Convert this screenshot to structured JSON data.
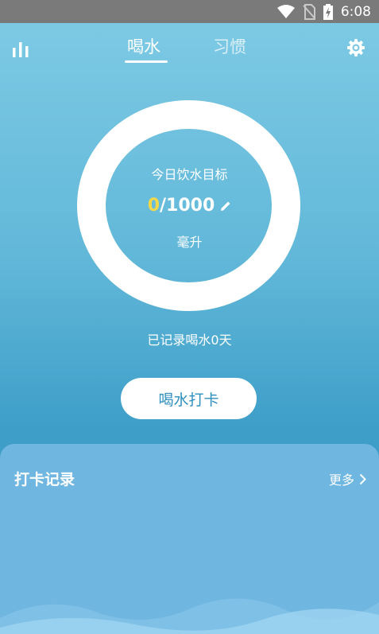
{
  "status": {
    "time": "6:08"
  },
  "tabs": [
    {
      "label": "喝水"
    },
    {
      "label": "习惯"
    }
  ],
  "goal": {
    "label": "今日饮水目标",
    "current": "0",
    "separator_target": "/1000",
    "unit": "毫升"
  },
  "recorded_text": "已记录喝水0天",
  "checkin_button": "喝水打卡",
  "records": {
    "title": "打卡记录",
    "more": "更多"
  },
  "colors": {
    "ring": "#ffffff",
    "accent_yellow": "#f3d94a",
    "button_text": "#2f8fbd"
  },
  "icons": [
    "wifi-icon",
    "no-sim-icon",
    "battery-icon",
    "bar-chart-icon",
    "gear-icon",
    "pencil-icon",
    "chevron-right-icon"
  ]
}
